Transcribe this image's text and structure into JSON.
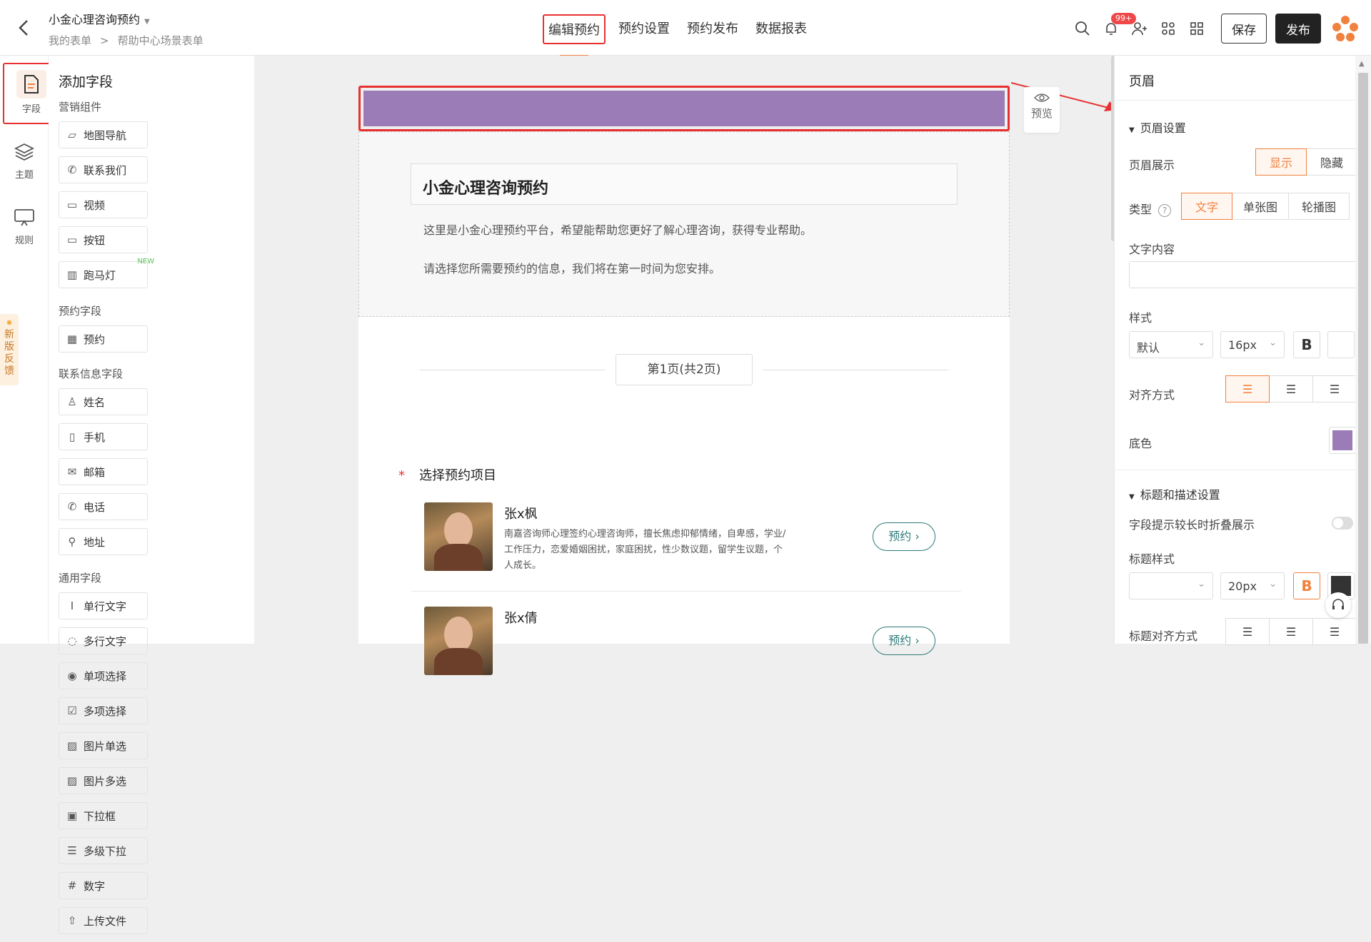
{
  "header": {
    "form_title": "小金心理咨询预约",
    "breadcrumb": [
      "我的表单",
      ">",
      "帮助中心场景表单"
    ],
    "tabs": [
      "编辑预约",
      "预约设置",
      "预约发布",
      "数据报表"
    ],
    "notification_badge": "99+",
    "save_label": "保存",
    "publish_label": "发布"
  },
  "rail": {
    "items": [
      "字段",
      "主题",
      "规则"
    ],
    "feedback": [
      "新",
      "版",
      "反",
      "馈"
    ]
  },
  "fields_panel": {
    "title": "添加字段",
    "sections": [
      {
        "name": "营销组件",
        "items": [
          {
            "label": "地图导航",
            "icon": "map-icon"
          },
          {
            "label": "联系我们",
            "icon": "phone-call-icon"
          },
          {
            "label": "视频",
            "icon": "video-icon"
          },
          {
            "label": "按钮",
            "icon": "button-icon"
          },
          {
            "label": "跑马灯",
            "icon": "marquee-icon",
            "tag": "NEW"
          }
        ]
      },
      {
        "name": "预约字段",
        "items": [
          {
            "label": "预约",
            "icon": "calendar-icon"
          }
        ]
      },
      {
        "name": "联系信息字段",
        "items": [
          {
            "label": "姓名",
            "icon": "person-icon"
          },
          {
            "label": "手机",
            "icon": "mobile-icon"
          },
          {
            "label": "邮箱",
            "icon": "mail-icon"
          },
          {
            "label": "电话",
            "icon": "phone-icon"
          },
          {
            "label": "地址",
            "icon": "location-icon"
          }
        ]
      },
      {
        "name": "通用字段",
        "items": [
          {
            "label": "单行文字",
            "icon": "text-icon"
          },
          {
            "label": "多行文字",
            "icon": "comment-icon"
          },
          {
            "label": "单项选择",
            "icon": "radio-icon"
          },
          {
            "label": "多项选择",
            "icon": "checkbox-icon"
          },
          {
            "label": "图片单选",
            "icon": "image-icon"
          },
          {
            "label": "图片多选",
            "icon": "images-icon"
          },
          {
            "label": "下拉框",
            "icon": "dropdown-icon"
          },
          {
            "label": "多级下拉",
            "icon": "multi-dropdown-icon"
          },
          {
            "label": "数字",
            "icon": "number-icon"
          },
          {
            "label": "上传文件",
            "icon": "upload-icon"
          }
        ]
      }
    ]
  },
  "canvas": {
    "preview_label": "预览",
    "header_color": "#9b7cb6",
    "form_title": "小金心理咨询预约",
    "intro_lines": [
      "这里是小金心理预约平台，希望能帮助您更好了解心理咨询，获得专业帮助。",
      "请选择您所需要预约的信息，我们将在第一时间为您安排。"
    ],
    "pager": "第1页(共2页)",
    "question_star": "*",
    "question": "选择预约项目",
    "consultants": [
      {
        "name": "张x枫",
        "desc": "南嘉咨询师心理签约心理咨询师，擅长焦虑抑郁情绪，自卑感，学业/工作压力，恋爱婚姻困扰，家庭困扰，性少数议题，留学生议题，个人成长。",
        "button": "预约"
      },
      {
        "name": "张x倩",
        "desc": "",
        "button": "预约"
      }
    ]
  },
  "props": {
    "title": "页眉",
    "group1": "页眉设置",
    "display_label": "页眉展示",
    "display_options": [
      "显示",
      "隐藏"
    ],
    "display_selected": "显示",
    "type_label": "类型",
    "type_options": [
      "文字",
      "单张图",
      "轮播图"
    ],
    "type_selected": "文字",
    "text_content_label": "文字内容",
    "text_content_value": "",
    "style_label": "样式",
    "style_font": "默认",
    "style_size": "16px",
    "bold_glyph": "B",
    "align_label": "对齐方式",
    "bg_label": "底色",
    "bg_color": "#9b7cb6",
    "group2": "标题和描述设置",
    "collapse_label": "字段提示较长时折叠展示",
    "title_style_label": "标题样式",
    "title_style_font": "",
    "title_style_size": "20px",
    "title_align_label": "标题对齐方式"
  }
}
